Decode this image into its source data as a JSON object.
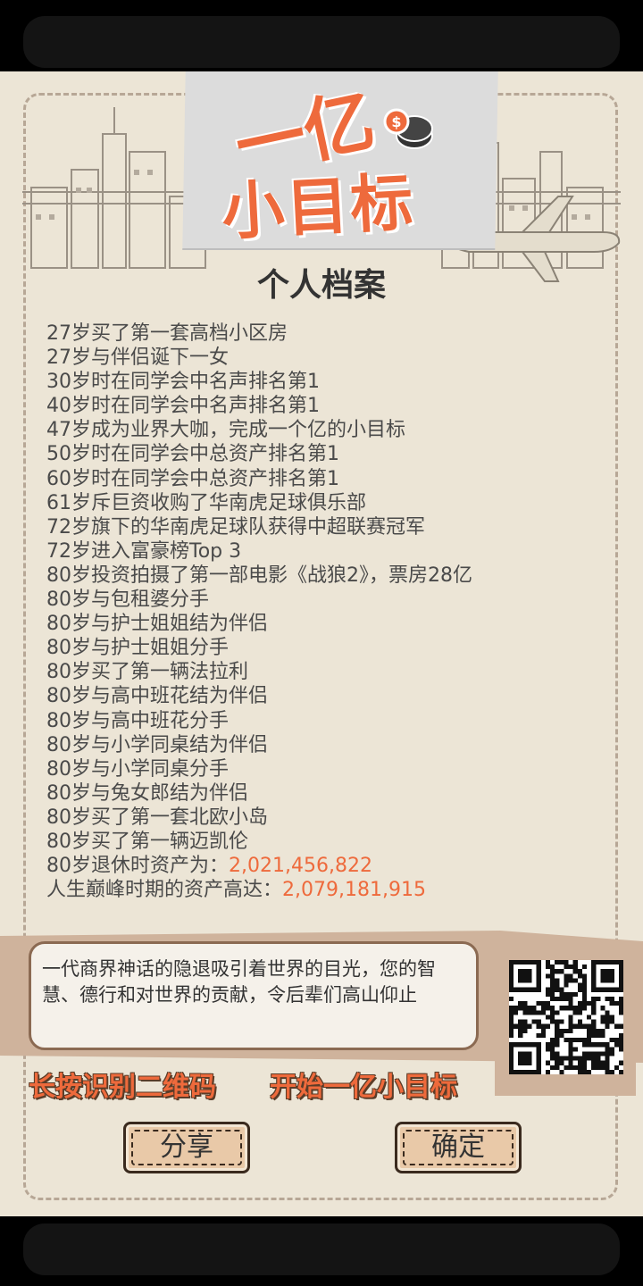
{
  "logo": {
    "line1": "一亿",
    "line2": "小目标"
  },
  "title": "个人档案",
  "records": [
    "27岁买了第一套高档小区房",
    "27岁与伴侣诞下一女",
    "30岁时在同学会中名声排名第1",
    "40岁时在同学会中名声排名第1",
    "47岁成为业界大咖，完成一个亿的小目标",
    "50岁时在同学会中总资产排名第1",
    "60岁时在同学会中总资产排名第1",
    "61岁斥巨资收购了华南虎足球俱乐部",
    "72岁旗下的华南虎足球队获得中超联赛冠军",
    "72岁进入富豪榜Top 3",
    "80岁投资拍摄了第一部电影《战狼2》，票房28亿",
    "80岁与包租婆分手",
    "80岁与护士姐姐结为伴侣",
    "80岁与护士姐姐分手",
    "80岁买了第一辆法拉利",
    "80岁与高中班花结为伴侣",
    "80岁与高中班花分手",
    "80岁与小学同桌结为伴侣",
    "80岁与小学同桌分手",
    "80岁与兔女郎结为伴侣",
    "80岁买了第一套北欧小岛",
    "80岁买了第一辆迈凯伦"
  ],
  "summary": {
    "retire_label": "80岁退休时资产为：",
    "retire_value": "2,021,456,822",
    "peak_label": "人生巅峰时期的资产高达：",
    "peak_value": "2,079,181,915"
  },
  "message": "一代商界神话的隐退吸引着世界的目光，您的智慧、德行和对世界的贡献，令后辈们高山仰止",
  "hints": {
    "qr": "长按识别二维码",
    "start": "开始一亿小目标"
  },
  "buttons": {
    "share": "分享",
    "ok": "确定"
  },
  "colors": {
    "accent": "#ee6a3c",
    "paper": "#ece5d6",
    "band": "#cfb39c",
    "text": "#4a4a4a"
  },
  "icons": {
    "coins": "coin-stack-icon",
    "qr": "qr-code"
  }
}
